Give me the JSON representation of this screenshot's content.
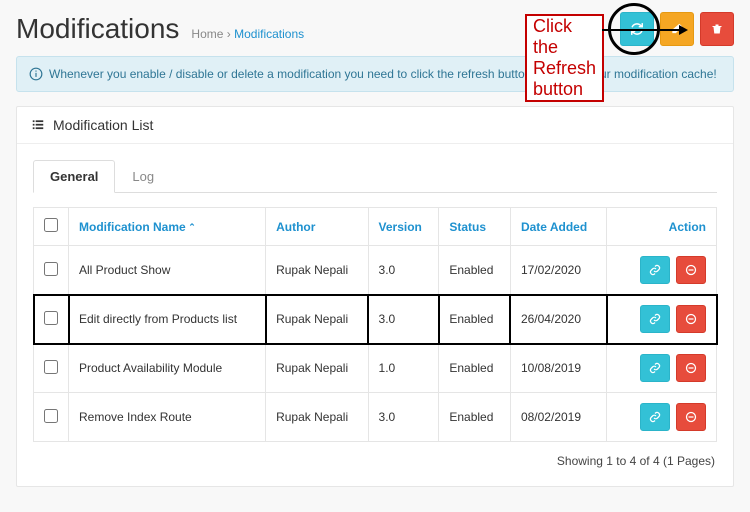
{
  "page": {
    "title": "Modifications",
    "breadcrumb_home": "Home",
    "breadcrumb_sep": "›",
    "breadcrumb_current": "Modifications"
  },
  "annotation": {
    "text": "Click the Refresh button"
  },
  "alert": {
    "text": "Whenever you enable / disable or delete a modification you need to click the refresh button to rebuild your modification cache!"
  },
  "panel": {
    "title": "Modification List"
  },
  "tabs": {
    "general": "General",
    "log": "Log"
  },
  "columns": {
    "name": "Modification Name",
    "author": "Author",
    "version": "Version",
    "status": "Status",
    "date": "Date Added",
    "action": "Action"
  },
  "rows": [
    {
      "name": "All Product Show",
      "author": "Rupak Nepali",
      "version": "3.0",
      "status": "Enabled",
      "date": "17/02/2020",
      "highlight": false
    },
    {
      "name": "Edit directly from Products list",
      "author": "Rupak Nepali",
      "version": "3.0",
      "status": "Enabled",
      "date": "26/04/2020",
      "highlight": true
    },
    {
      "name": "Product Availability Module",
      "author": "Rupak Nepali",
      "version": "1.0",
      "status": "Enabled",
      "date": "10/08/2019",
      "highlight": false
    },
    {
      "name": "Remove Index Route",
      "author": "Rupak Nepali",
      "version": "3.0",
      "status": "Enabled",
      "date": "08/02/2019",
      "highlight": false
    }
  ],
  "footer": {
    "text": "Showing 1 to 4 of 4 (1 Pages)"
  }
}
